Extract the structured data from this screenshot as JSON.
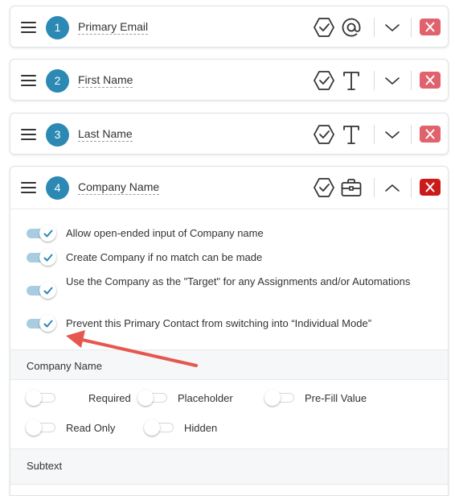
{
  "fields": [
    {
      "number": "1",
      "label": "Primary Email",
      "type_icon": "at-sign-icon",
      "expanded": false
    },
    {
      "number": "2",
      "label": "First Name",
      "type_icon": "text-type-icon",
      "expanded": false
    },
    {
      "number": "3",
      "label": "Last Name",
      "type_icon": "text-type-icon",
      "expanded": false
    },
    {
      "number": "4",
      "label": "Company Name",
      "type_icon": "briefcase-icon",
      "expanded": true
    }
  ],
  "expanded_options": [
    {
      "label": "Allow open-ended input of Company name",
      "checked": true
    },
    {
      "label": "Create Company if no match can be made",
      "checked": true
    },
    {
      "label": "Use the Company as the \"Target\" for any Assignments and/or Automations",
      "checked": true
    },
    {
      "label": "Prevent this Primary Contact from switching into “Individual Mode”",
      "checked": true
    }
  ],
  "section_company": {
    "title": "Company Name",
    "toggles": [
      {
        "label": "Required",
        "on": false
      },
      {
        "label": "Placeholder",
        "on": false
      },
      {
        "label": "Pre-Fill Value",
        "on": false
      },
      {
        "label": "Read Only",
        "on": false
      },
      {
        "label": "Hidden",
        "on": false
      }
    ]
  },
  "section_subtext": {
    "title": "Subtext"
  },
  "colors": {
    "badge": "#2b89b3",
    "delete": "#e0626c",
    "delete_active": "#cc1a1a",
    "toggle_on": "#a8cde2",
    "check": "#2b89b3",
    "annotation_arrow": "#e5584f"
  }
}
